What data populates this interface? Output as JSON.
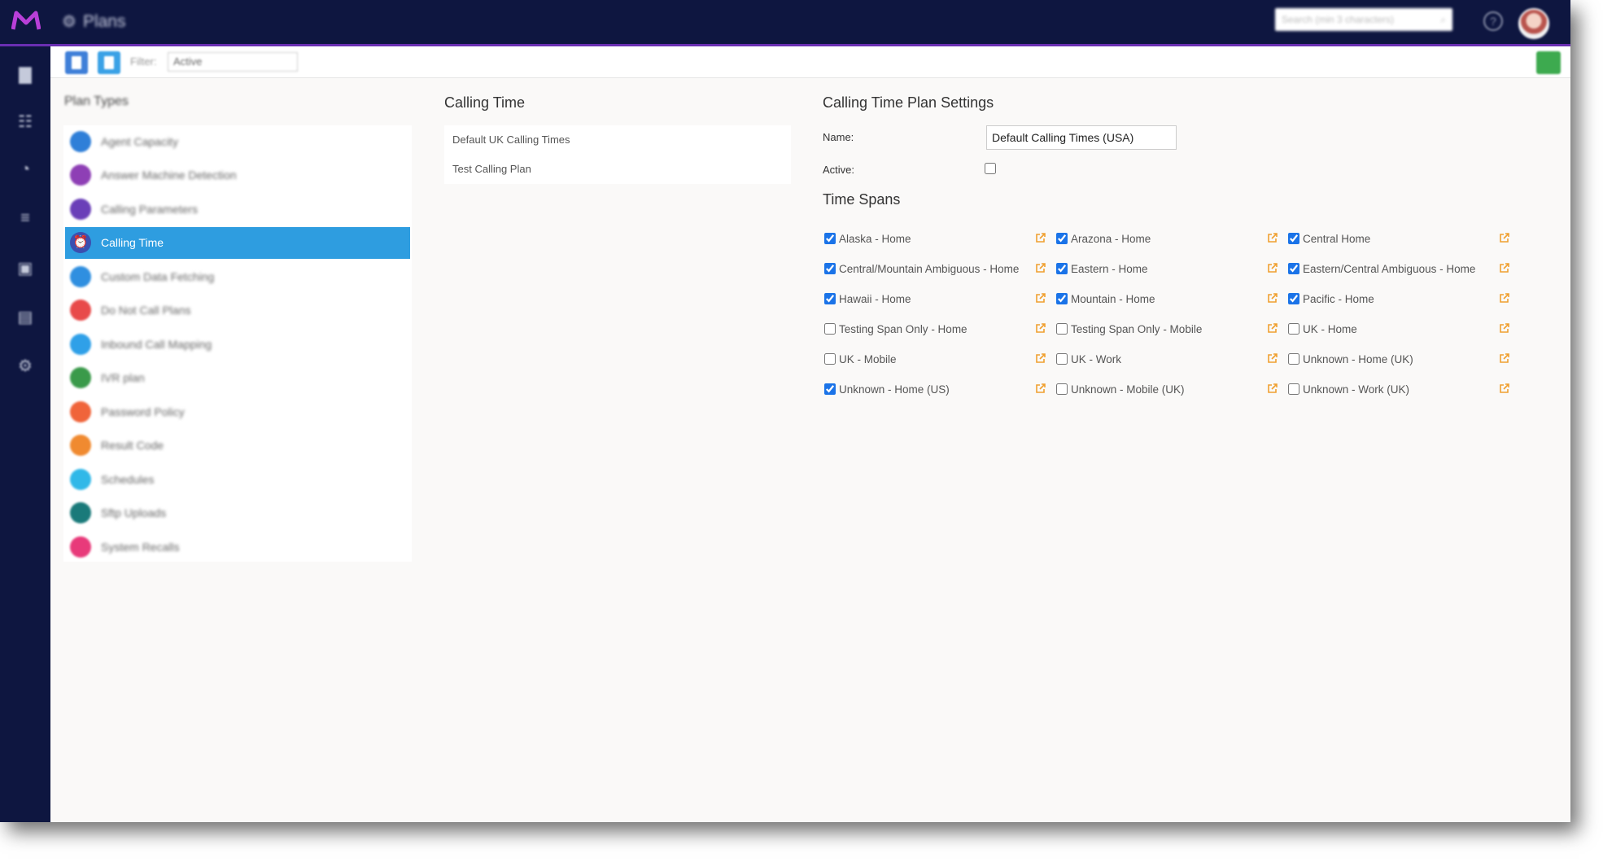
{
  "header": {
    "app_title": "Plans",
    "search_placeholder": "Search (min 3 characters)"
  },
  "toolbar": {
    "filter_label": "Filter:",
    "filter_value": "Active"
  },
  "plan_types": {
    "title": "Plan Types",
    "items": [
      {
        "label": "Agent Capacity",
        "color": "#2f7fd8"
      },
      {
        "label": "Answer Machine Detection",
        "color": "#8e3fb5"
      },
      {
        "label": "Calling Parameters",
        "color": "#6a3fb8"
      },
      {
        "label": "Calling Time",
        "color": "#3b4fb0",
        "active": true
      },
      {
        "label": "Custom Data Fetching",
        "color": "#2f8fe0"
      },
      {
        "label": "Do Not Call Plans",
        "color": "#e84a4a"
      },
      {
        "label": "Inbound Call Mapping",
        "color": "#2fa0e8"
      },
      {
        "label": "IVR plan",
        "color": "#3a9a4a"
      },
      {
        "label": "Password Policy",
        "color": "#f0643a"
      },
      {
        "label": "Result Code",
        "color": "#f08a30"
      },
      {
        "label": "Schedules",
        "color": "#30b8e8"
      },
      {
        "label": "Sftp Uploads",
        "color": "#1a7a7a"
      },
      {
        "label": "System Recalls",
        "color": "#e83a7a"
      }
    ]
  },
  "calling_time": {
    "title": "Calling Time",
    "plans": [
      "Default UK Calling Times",
      "Test Calling Plan"
    ]
  },
  "settings": {
    "title": "Calling Time Plan Settings",
    "name_label": "Name:",
    "name_value": "Default Calling Times (USA)",
    "active_label": "Active:",
    "time_spans_title": "Time Spans",
    "spans": [
      {
        "label": "Alaska - Home",
        "checked": true
      },
      {
        "label": "Arazona - Home",
        "checked": true
      },
      {
        "label": "Central Home",
        "checked": true
      },
      {
        "label": "Central/Mountain Ambiguous - Home",
        "checked": true
      },
      {
        "label": "Eastern - Home",
        "checked": true
      },
      {
        "label": "Eastern/Central Ambiguous - Home",
        "checked": true
      },
      {
        "label": "Hawaii - Home",
        "checked": true
      },
      {
        "label": "Mountain - Home",
        "checked": true
      },
      {
        "label": "Pacific - Home",
        "checked": true
      },
      {
        "label": "Testing Span Only - Home",
        "checked": false
      },
      {
        "label": "Testing Span Only - Mobile",
        "checked": false
      },
      {
        "label": "UK - Home",
        "checked": false
      },
      {
        "label": "UK - Mobile",
        "checked": false
      },
      {
        "label": "UK - Work",
        "checked": false
      },
      {
        "label": "Unknown - Home (UK)",
        "checked": false
      },
      {
        "label": "Unknown - Home (US)",
        "checked": true
      },
      {
        "label": "Unknown - Mobile (UK)",
        "checked": false
      },
      {
        "label": "Unknown - Work (UK)",
        "checked": false
      }
    ]
  },
  "colors": {
    "topbar": "#0e1640",
    "accent_purple": "#6a2fb2",
    "selected_blue": "#2e9de0",
    "edit_icon_orange": "#f0a030"
  }
}
